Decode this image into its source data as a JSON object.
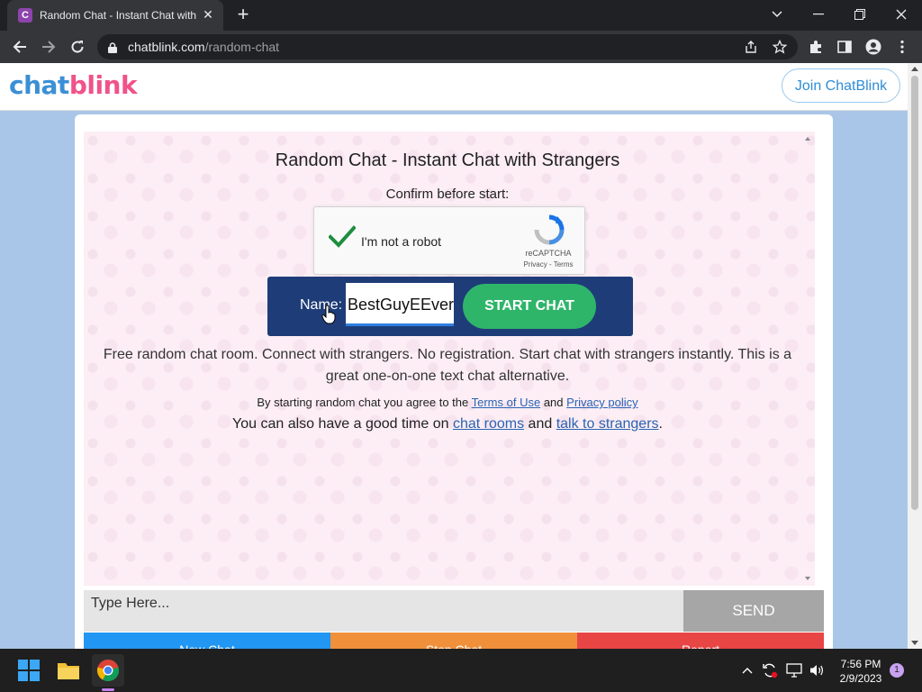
{
  "browser": {
    "tab_title": "Random Chat - Instant Chat with",
    "favicon_letter": "C",
    "url_domain": "chatblink.com",
    "url_path": "/random-chat"
  },
  "site": {
    "logo_part1": "chat",
    "logo_part2": "blink",
    "join_label": "Join ChatBlink"
  },
  "chat": {
    "title": "Random Chat - Instant Chat with Strangers",
    "confirm": "Confirm before start:",
    "captcha_label": "I'm not a robot",
    "captcha_brand": "reCAPTCHA",
    "captcha_links": "Privacy - Terms",
    "name_label": "Name:",
    "name_value": "BestGuyEEver",
    "start_label": "START CHAT",
    "description": "Free random chat room. Connect with strangers. No registration. Start chat with strangers instantly. This is a great one-on-one text chat alternative.",
    "terms_prefix": "By starting random chat you agree to the",
    "terms_link": "Terms of Use",
    "terms_and": "and",
    "privacy_link": "Privacy policy",
    "also_prefix": "You can also have a good time on",
    "rooms_link": "chat rooms",
    "also_and": "and",
    "strangers_link": "talk to strangers",
    "also_suffix": ".",
    "input_placeholder": "Type Here...",
    "send_label": "SEND",
    "new_chat_label": "New Chat",
    "stop_label": "Stop Chat",
    "report_label": "Report"
  },
  "taskbar": {
    "time": "7:56 PM",
    "date": "2/9/2023",
    "notification_count": "1"
  },
  "colors": {
    "page_bg": "#a9c6e8",
    "chat_bg": "#fceef4",
    "name_bar": "#1e3d78",
    "start_button": "#2fb56a",
    "send_button": "#a6a6a6",
    "new_chat": "#2196f3",
    "stop_chat": "#f0903a",
    "report": "#e84545"
  }
}
